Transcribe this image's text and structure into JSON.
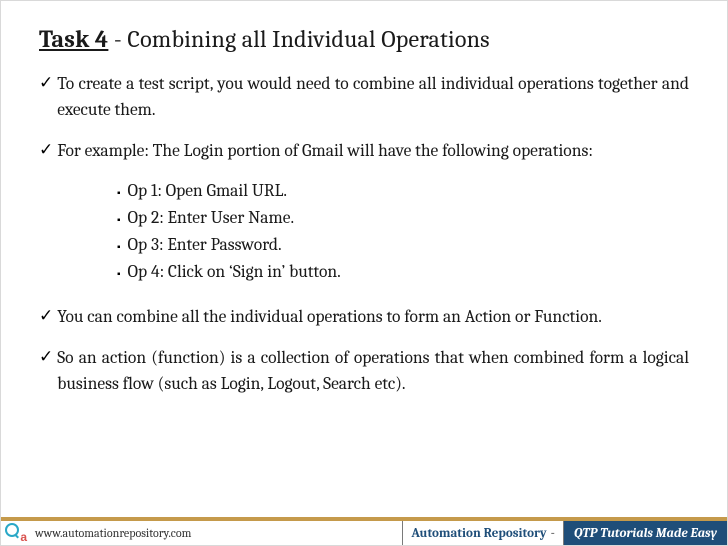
{
  "title": {
    "lead": "Task 4",
    "rest": " - Combining all Individual Operations"
  },
  "paragraphs": {
    "p1": "To create a test script, you would need to combine all individual operations together and execute them.",
    "p2": "For example: The Login portion of Gmail will have the following operations:",
    "p3": "You can combine all the individual operations to form an Action or Function.",
    "p4": "So an action (function) is a collection of operations that when combined form a logical business flow (such as Login, Logout, Search etc)."
  },
  "operations": {
    "op1": "Op 1: Open Gmail URL.",
    "op2": "Op 2: Enter User Name.",
    "op3": "Op 3: Enter Password.",
    "op4": "Op 4: Click on ‘Sign in’ button."
  },
  "footer": {
    "url": "www.automationrepository.com",
    "mid": "Automation Repository",
    "dash": "-",
    "right": "QTP Tutorials Made Easy",
    "logo_a": "a"
  },
  "marks": {
    "tick": "✓",
    "square": "▪"
  }
}
